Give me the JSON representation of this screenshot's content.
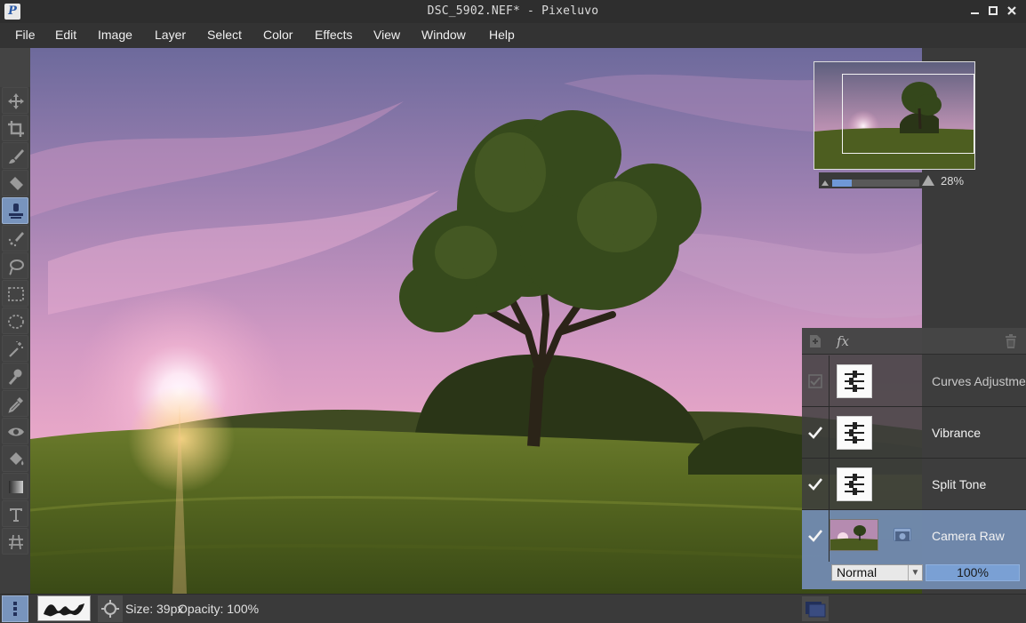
{
  "window": {
    "title": "DSC_5902.NEF* - Pixeluvo",
    "app_icon_letter": "P"
  },
  "menu": [
    "File",
    "Edit",
    "Image",
    "Layer",
    "Select",
    "Color",
    "Effects",
    "View",
    "Window",
    "Help"
  ],
  "tools": [
    {
      "name": "move-tool",
      "icon": "move-icon"
    },
    {
      "name": "crop-tool",
      "icon": "crop-icon"
    },
    {
      "name": "brush-tool",
      "icon": "brush-icon"
    },
    {
      "name": "eraser-tool",
      "icon": "eraser-icon"
    },
    {
      "name": "clone-stamp-tool",
      "icon": "stamp-icon",
      "active": true
    },
    {
      "name": "healing-tool",
      "icon": "healing-brush-icon"
    },
    {
      "name": "lasso-tool",
      "icon": "lasso-icon"
    },
    {
      "name": "rect-select-tool",
      "icon": "rect-select-icon"
    },
    {
      "name": "ellipse-select-tool",
      "icon": "ellipse-select-icon"
    },
    {
      "name": "magic-wand-tool",
      "icon": "magic-wand-icon"
    },
    {
      "name": "smudge-tool",
      "icon": "smudge-icon"
    },
    {
      "name": "color-picker-tool",
      "icon": "eyedropper-icon"
    },
    {
      "name": "red-eye-tool",
      "icon": "eye-icon"
    },
    {
      "name": "paint-bucket-tool",
      "icon": "paint-bucket-icon"
    },
    {
      "name": "gradient-tool",
      "icon": "gradient-icon"
    },
    {
      "name": "text-tool",
      "icon": "text-icon"
    },
    {
      "name": "perspective-tool",
      "icon": "perspective-icon"
    }
  ],
  "navigator": {
    "zoom": "28%",
    "zoom_fraction": 0.22
  },
  "layers": {
    "items": [
      {
        "name": "Curves Adjustment",
        "visible": true,
        "dim": true,
        "kind": "adjustment"
      },
      {
        "name": "Vibrance",
        "visible": true,
        "kind": "adjustment"
      },
      {
        "name": "Split Tone",
        "visible": true,
        "kind": "adjustment"
      },
      {
        "name": "Camera Raw",
        "visible": true,
        "kind": "image",
        "selected": true
      }
    ],
    "blend_mode": "Normal",
    "opacity": "100%"
  },
  "status": {
    "size": "Size: 39px",
    "opacity": "Opacity: 100%"
  },
  "colors": {
    "accent": "#7894bd",
    "slider": "#7aa0d4"
  }
}
